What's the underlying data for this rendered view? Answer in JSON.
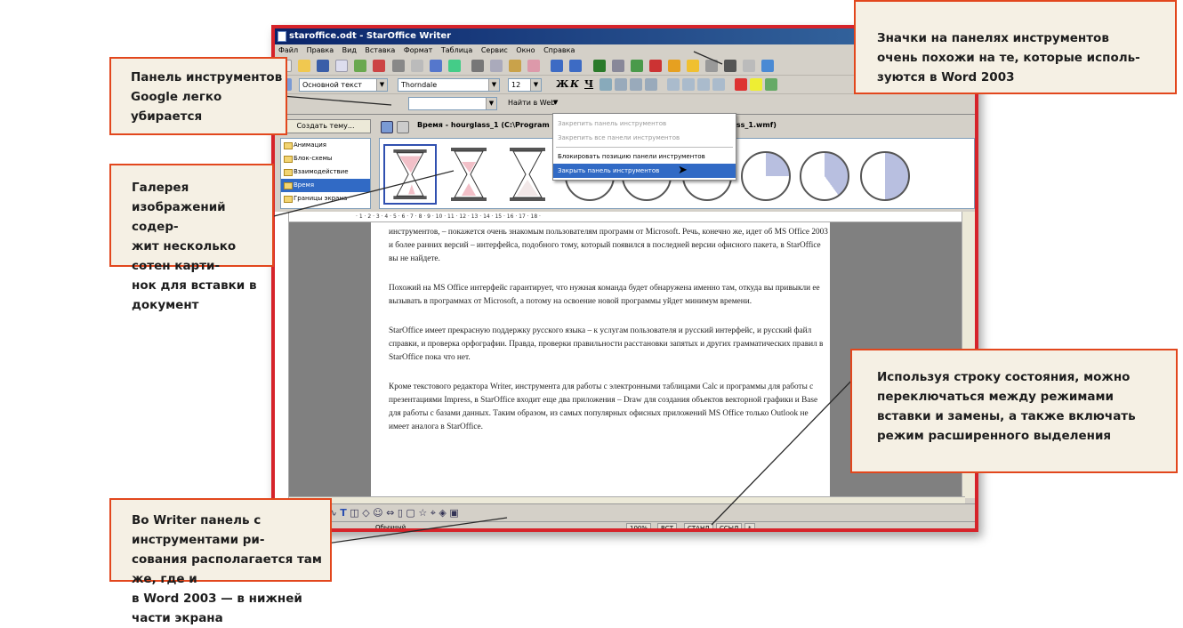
{
  "window": {
    "title": "staroffice.odt - StarOffice Writer",
    "menu": [
      "Файл",
      "Правка",
      "Вид",
      "Вставка",
      "Формат",
      "Таблица",
      "Сервис",
      "Окно",
      "Справка"
    ],
    "style_combo": "Основной текст",
    "font_combo": "Thorndale",
    "size_combo": "12",
    "fmt_bold": "Ж",
    "fmt_italic": "К",
    "fmt_underline": "Ч",
    "search_label": "Найти в Web"
  },
  "context_menu": {
    "items": [
      {
        "label": "Закрепить панель инструментов",
        "enabled": false
      },
      {
        "label": "Закрепить все панели инструментов",
        "enabled": false
      },
      {
        "label": "Блокировать позицию панели инструментов",
        "enabled": true
      },
      {
        "label": "Закрыть панель инструментов",
        "enabled": true,
        "highlighted": true
      }
    ]
  },
  "gallery": {
    "create_theme": "Создать тему...",
    "title": "Время - hourglass_1 (C:\\Program Fi",
    "title_tail": "glass_1.wmf)",
    "themes": [
      "Анимация",
      "Блок-схемы",
      "Взаимодействие",
      "Время",
      "Границы экрана"
    ]
  },
  "ruler": "· 1 · 2 · 3 · 4 · 5 · 6 · 7 · 8 · 9 · 10 · 11 · 12 · 13 · 14 · 15 · 16 · 17 · 18 ·",
  "document": {
    "paragraphs": [
      "инструментов, – покажется очень знакомым пользователям программ от Microsoft. Речь, конечно же, идет об MS Office 2003 и более ранних версий – интерфейса, подобного тому, который появился в последней версии офисного пакета, в StarOffice вы не найдете.",
      "Похожий на MS Office интерфейс гарантирует, что нужная команда будет обнаружена именно там, откуда вы привыкли ее вызывать в программах от Microsoft, а потому на освоение новой программы уйдет минимум времени.",
      "StarOffice имеет прекрасную поддержку русского языка – к услугам пользователя и русский интерфейс, и русский файл справки, и проверка орфографии. Правда, проверки правильности расстановки запятых и других грамматических правил в StarOffice пока что нет.",
      "Кроме текстового редактора Writer, инструмента для работы с электронными таблицами Calc и программы для работы с презентациями Impress, в StarOffice входит еще два приложения – Draw для создания объектов векторной графики и Base для работы с базами данных. Таким образом, из самых популярных офисных приложений MS Office только Outlook не имеет аналога в StarOffice."
    ]
  },
  "statusbar": {
    "style": "Обычный",
    "zoom": "100%",
    "insert_mode": "ВСТ",
    "selection_mode": "СТАНД",
    "hyperlink_mode": "ССЫЛ",
    "modified": "*"
  },
  "callouts": {
    "google": [
      "Панель инструментов",
      "Google легко убирается"
    ],
    "icons": [
      "Значки на панелях инструментов",
      "очень похожи на те, которые исполь-",
      "зуются в Word 2003"
    ],
    "gallery": [
      "Галерея изображений содер-",
      "жит несколько сотен карти-",
      "нок для вставки в документ"
    ],
    "status": [
      "Используя строку состояния, можно",
      "переключаться между режимами",
      "вставки и замены, а также включать",
      "режим расширенного выделения"
    ],
    "draw": [
      "Во Writer панель с инструментами ри-",
      "сования располагается там же, где и",
      "в Word 2003 — в нижней части экрана"
    ]
  },
  "colors": {
    "accent_red": "#d6232a",
    "callout_bg": "#f5f0e4",
    "callout_border": "#e2471d",
    "selection": "#316ac5"
  }
}
